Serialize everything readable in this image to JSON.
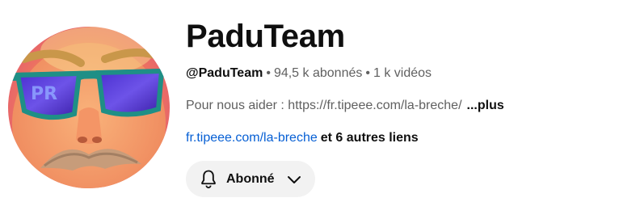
{
  "channel": {
    "name": "PaduTeam",
    "handle": "@PaduTeam",
    "separator": "•",
    "subscribers": "94,5 k abonnés",
    "videos": "1 k vidéos",
    "description": "Pour nous aider : https://fr.tipeee.com/la-breche/",
    "more_label": "...plus",
    "link_text": "fr.tipeee.com/la-breche",
    "other_links": "et 6 autres liens"
  },
  "subscribe_button": {
    "label": "Abonné",
    "icon": "bell-icon",
    "dropdown_icon": "chevron-down-icon"
  },
  "colors": {
    "link": "#065fd4",
    "button_bg": "#f2f2f2",
    "text_primary": "#0f0f0f",
    "text_secondary": "#606060"
  }
}
